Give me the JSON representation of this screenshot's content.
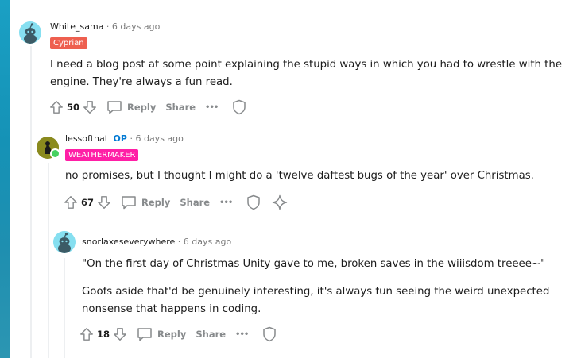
{
  "comments": [
    {
      "username": "White_sama",
      "time": "6 days ago",
      "flair": "Cyprian",
      "flair_color": "#ee5f4f",
      "text": "I need a blog post at some point explaining the stupid ways in which you had to wrestle with the engine. They're always a fun read.",
      "score": "50",
      "reply_label": "Reply",
      "share_label": "Share",
      "more_label": "•••"
    },
    {
      "username": "lessofthat",
      "op_label": "OP",
      "time": "6 days ago",
      "flair": "WEATHERMAKER",
      "flair_color": "#ff1fa6",
      "text": "no promises, but I thought I might do a 'twelve daftest bugs of the year' over Christmas.",
      "score": "67",
      "reply_label": "Reply",
      "share_label": "Share",
      "more_label": "•••"
    },
    {
      "username": "snorlaxeseverywhere",
      "time": "6 days ago",
      "text_p1": "\"On the first day of Christmas Unity gave to me, broken saves in the wiiisdom treeee~\"",
      "text_p2": "Goofs aside that'd be genuinely interesting, it's always fun seeing the weird unexpected nonsense that happens in coding.",
      "score": "18",
      "reply_label": "Reply",
      "share_label": "Share",
      "more_label": "•••"
    }
  ],
  "separator": "·"
}
